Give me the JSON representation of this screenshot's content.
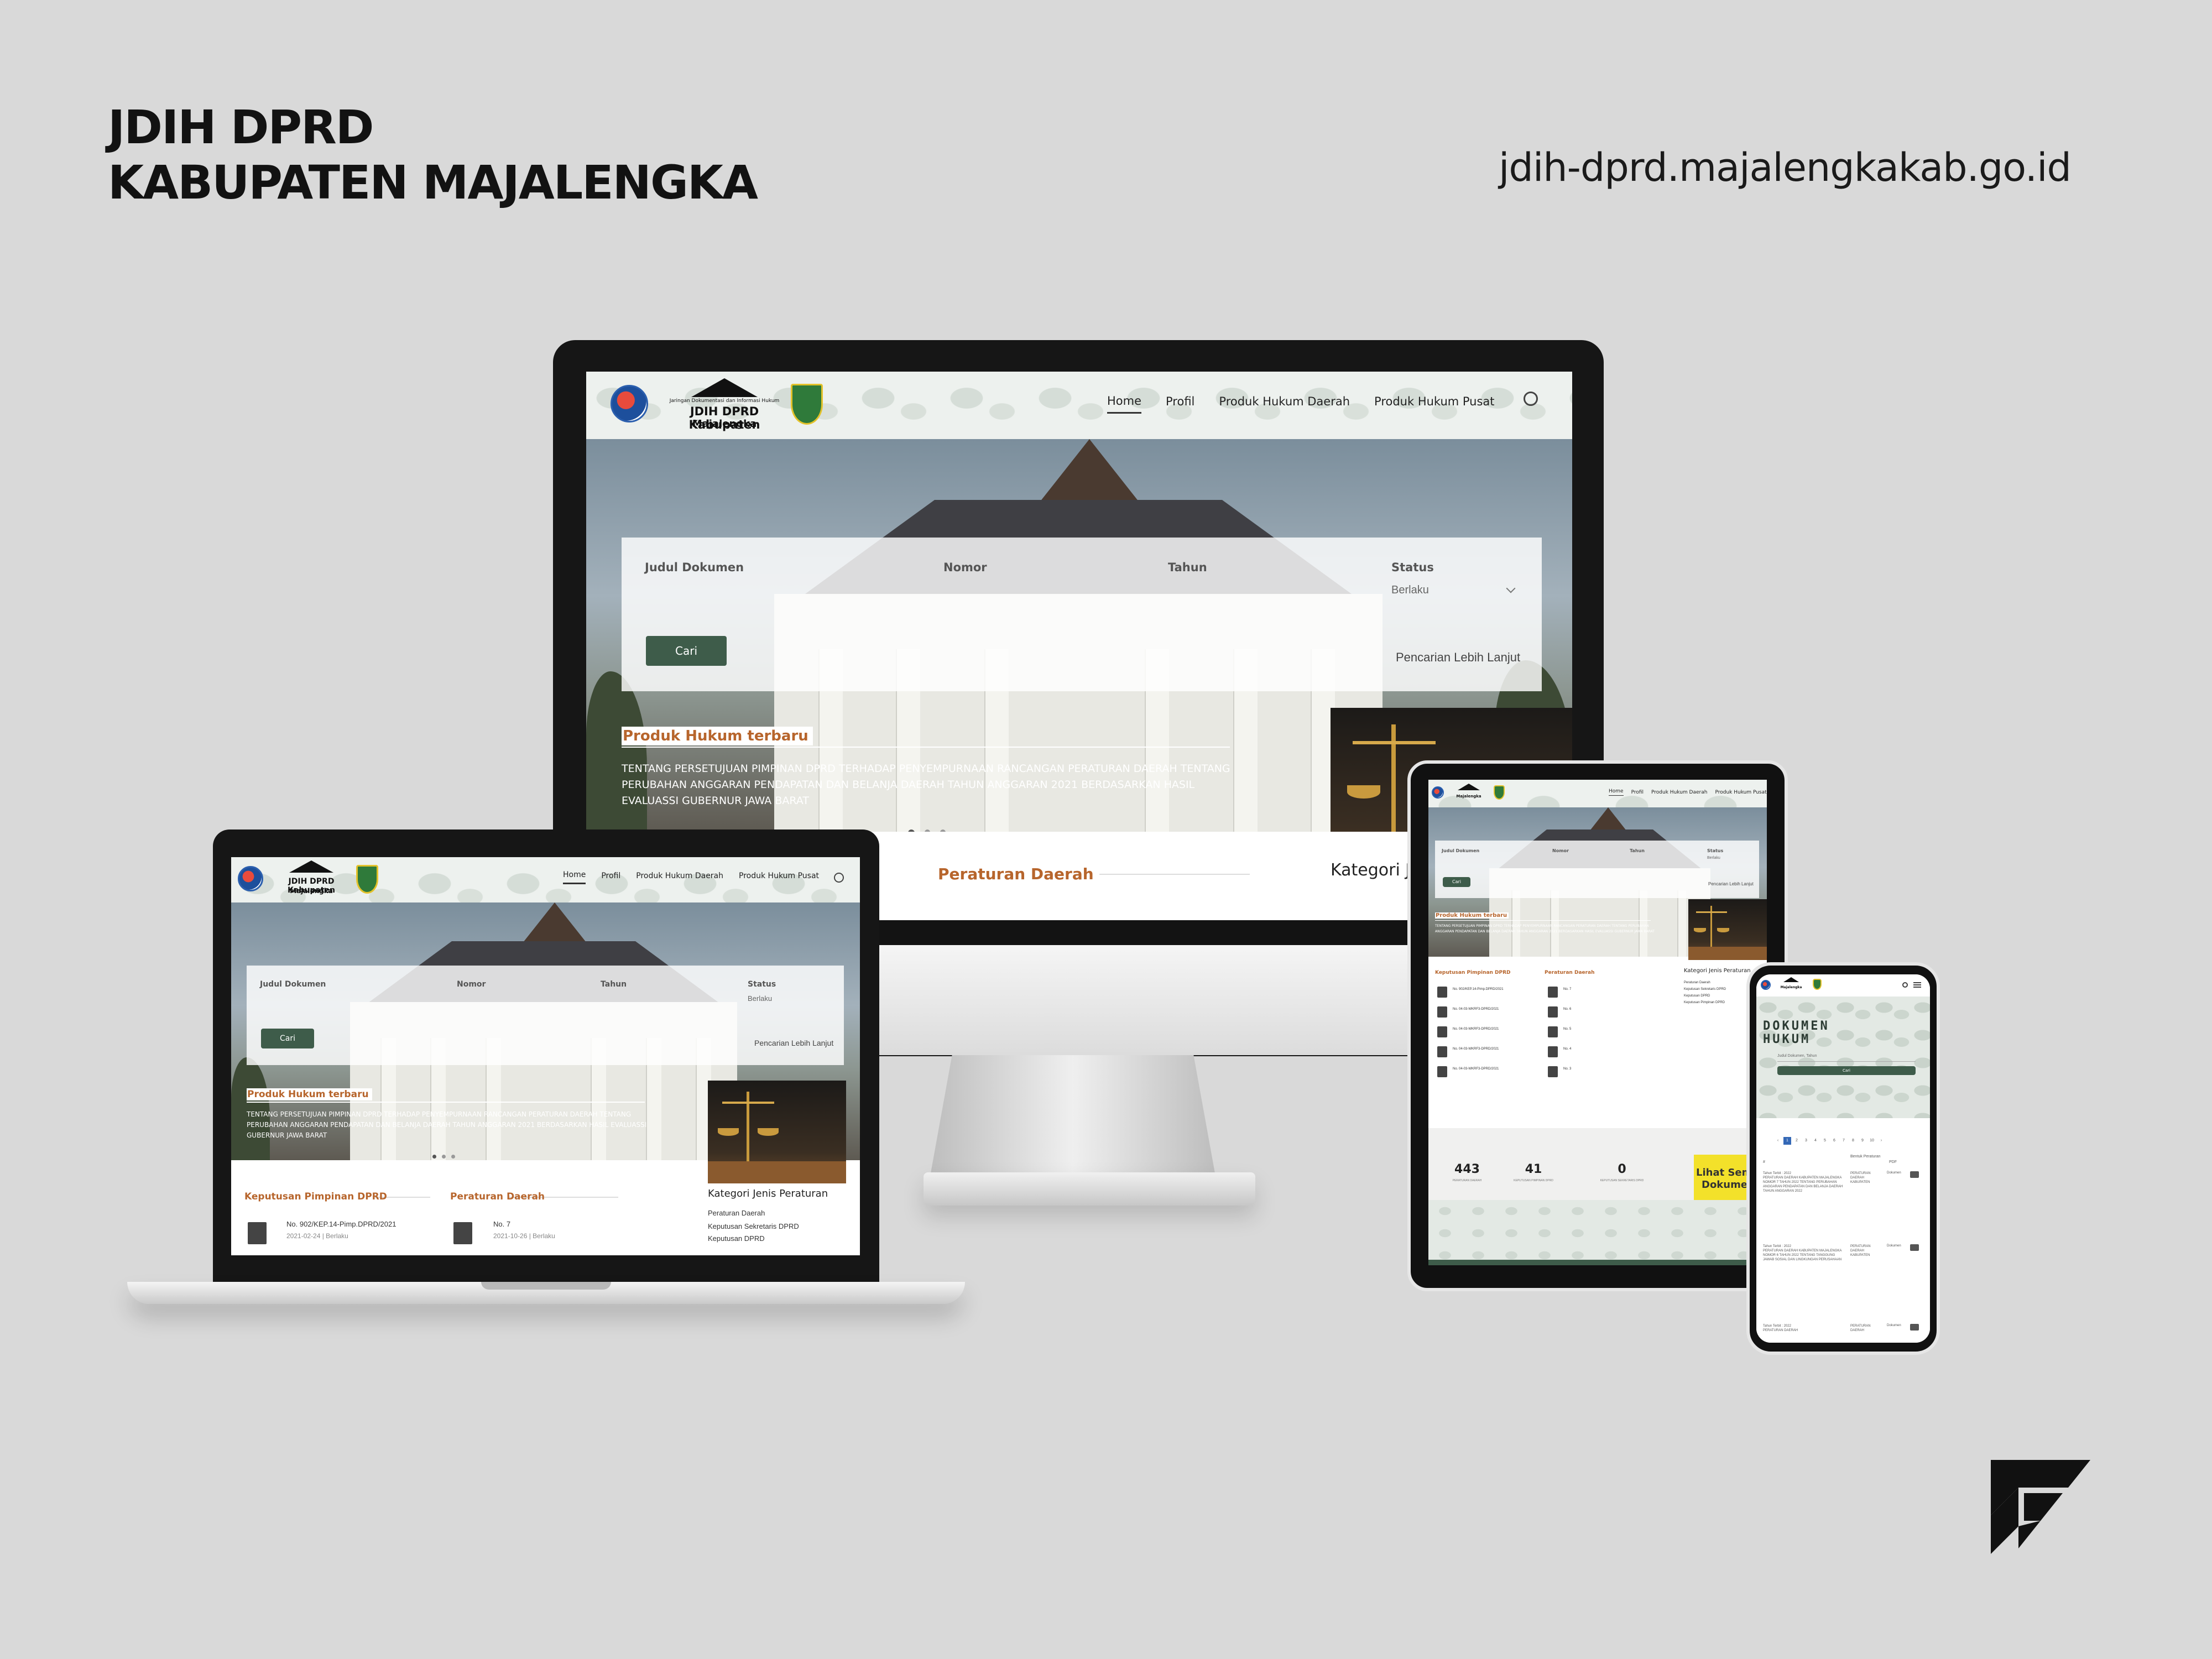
{
  "brand": {
    "title_line1": "JDIH DPRD",
    "title_line2": "KABUPATEN MAJALENGKA",
    "url": "jdih-dprd.majalengkakab.go.id"
  },
  "logo": {
    "org_small": "Jaringan Dokumentasi dan Informasi Hukum",
    "title_line1": "JDIH DPRD Kabupaten",
    "title_line2": "Majalengka"
  },
  "nav": {
    "items": [
      "Home",
      "Profil",
      "Produk Hukum Daerah",
      "Produk Hukum Pusat"
    ],
    "active": "Home"
  },
  "search": {
    "label_judul": "Judul Dokumen",
    "label_nomor": "Nomor",
    "label_tahun": "Tahun",
    "label_status": "Status",
    "status_value": "Berlaku",
    "button": "Cari",
    "advanced": "Pencarian Lebih Lanjut"
  },
  "news": {
    "title": "Produk Hukum terbaru",
    "text": "TENTANG PERSETUJUAN PIMPINAN DPRD TERHADAP PENYEMPURNAAN RANCANGAN PERATURAN DAERAH TENTANG PERUBAHAN ANGGARAN PENDAPATAN DAN BELANJA DAERAH TAHUN ANGGARAN 2021 BERDASARKAN HASIL EVALUASSI GUBERNUR JAWA BARAT",
    "title_laptop": "Produk Hukum terbaru"
  },
  "sections": {
    "keputusan": "Keputusan Pimpinan DPRD",
    "peraturan": "Peraturan Daerah",
    "kategori": "Kategori Jenis Peraturan",
    "kategori_partial": "Kategori Jen"
  },
  "kategori_items": [
    "Peraturan Daerah",
    "Keputusan Sekretaris DPRD",
    "Keputusan DPRD",
    "Keputusan Pimpinan DPRD"
  ],
  "laptop_docs": {
    "keputusan_no": "No. 902/KEP.14-Pimp.DPRD/2021",
    "keputusan_meta": "2021-02-24 | Berlaku",
    "perda_no": "No. 7",
    "perda_meta": "2021-10-26 | Berlaku"
  },
  "tablet_docs": {
    "keputusan": [
      "No. 902/KEP.14-Pimp.DPRD/2021",
      "No. 04-03-WKRF3-DPRD/2021",
      "No. 04-03-WKRF3-DPRD/2021",
      "No. 04-03-WKRF3-DPRD/2021",
      "No. 04-03-WKRF3-DPRD/2021"
    ],
    "perda": [
      "No. 7",
      "No. 6",
      "No. 5",
      "No. 4",
      "No. 3"
    ]
  },
  "stats": [
    {
      "value": "443",
      "label": "PERATURAN DAERAH"
    },
    {
      "value": "41",
      "label": "KEPUTUSAN PIMPINAN DPRD"
    },
    {
      "value": "0",
      "label": "KEPUTUSAN SEKRETARIS DPRD"
    }
  ],
  "cta": {
    "line1": "Lihat Sem",
    "line2": "Dokumen"
  },
  "phone": {
    "heading_line1": "DOKUMEN",
    "heading_line2": "HUKUM",
    "search_placeholder": "Judul Dokumen, Tahun",
    "button": "Cari",
    "pages": [
      "‹",
      "1",
      "2",
      "3",
      "4",
      "5",
      "6",
      "7",
      "8",
      "9",
      "10",
      "›"
    ],
    "current_page": "1",
    "table_headers": [
      "#",
      "Bentuk Peraturan",
      "PDF"
    ],
    "rows": [
      {
        "desc": "Tahun Terbit : 2022\nPERATURAN DAERAH KABUPATEN MAJALENGKA NOMOR 7 TAHUN 2022 TENTANG PERUBAHAN ANGGARAN PENDAPATAN DAN BELANJA DAERAH TAHUN ANGGARAN 2022",
        "type": "PERATURAN DAERAH KABUPATEN",
        "pdf": "Dokumen"
      },
      {
        "desc": "Tahun Terbit : 2022\nPERATURAN DAERAH KABUPATEN MAJALENGKA NOMOR 6 TAHUN 2022 TENTANG TANGGUNG JAWAB SOSIAL DAN LINGKUNGAN PERUSAHAAN",
        "type": "PERATURAN DAERAH KABUPATEN",
        "pdf": "Dokumen"
      },
      {
        "desc": "Tahun Terbit : 2022\nPERATURAN DAERAH",
        "type": "PERATURAN DAERAH",
        "pdf": "Dokumen"
      }
    ]
  },
  "colors": {
    "background": "#d9d9d9",
    "accent_green": "#3e5c4a",
    "accent_orange": "#b7652c",
    "cta_yellow": "#f3e12a",
    "pager_blue": "#3468b6"
  },
  "icons": [
    "globe-logo-icon",
    "house-logo-icon",
    "shield-logo-icon",
    "search-icon",
    "document-icon",
    "menu-icon",
    "download-icon",
    "brand-f-logo-icon"
  ]
}
